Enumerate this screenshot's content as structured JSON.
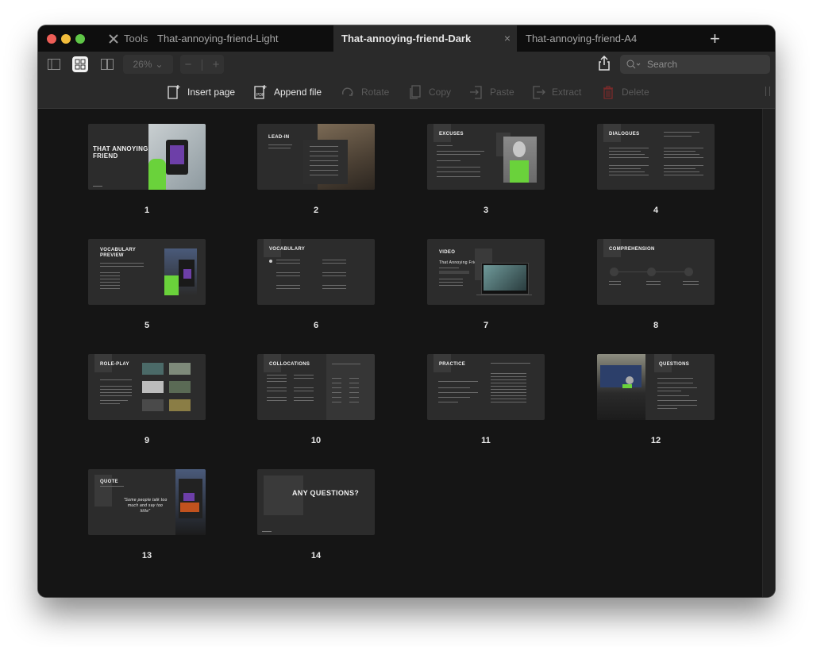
{
  "window": {
    "tools_label": "Tools",
    "tabs": [
      {
        "label": "That-annoying-friend-Light",
        "active": false
      },
      {
        "label": "That-annoying-friend-Dark",
        "active": true,
        "close": "×"
      },
      {
        "label": "That-annoying-friend-A4",
        "active": false
      }
    ],
    "new_tab": "+"
  },
  "toolbar": {
    "zoom_value": "26%",
    "zoom_minus": "−",
    "zoom_plus": "+",
    "search_placeholder": "Search",
    "actions": [
      {
        "label": "Insert page",
        "enabled": true
      },
      {
        "label": "Append file",
        "enabled": true
      },
      {
        "label": "Rotate",
        "enabled": false
      },
      {
        "label": "Copy",
        "enabled": false
      },
      {
        "label": "Paste",
        "enabled": false
      },
      {
        "label": "Extract",
        "enabled": false
      },
      {
        "label": "Delete",
        "enabled": false
      }
    ]
  },
  "pages": [
    {
      "number": "1",
      "title": "THAT ANNOYING FRIEND"
    },
    {
      "number": "2",
      "title": "LEAD-IN"
    },
    {
      "number": "3",
      "title": "EXCUSES"
    },
    {
      "number": "4",
      "title": "DIALOGUES"
    },
    {
      "number": "5",
      "title": "VOCABULARY PREVIEW"
    },
    {
      "number": "6",
      "title": "VOCABULARY"
    },
    {
      "number": "7",
      "title": "VIDEO",
      "subtitle": "That Annoying Friend"
    },
    {
      "number": "8",
      "title": "COMPREHENSION"
    },
    {
      "number": "9",
      "title": "ROLE-PLAY"
    },
    {
      "number": "10",
      "title": "COLLOCATIONS"
    },
    {
      "number": "11",
      "title": "PRACTICE"
    },
    {
      "number": "12",
      "title": "QUESTIONS"
    },
    {
      "number": "13",
      "title": "QUOTE",
      "quote": "\"Some people talk too much and say too little\""
    },
    {
      "number": "14",
      "title": "ANY QUESTIONS?"
    }
  ]
}
